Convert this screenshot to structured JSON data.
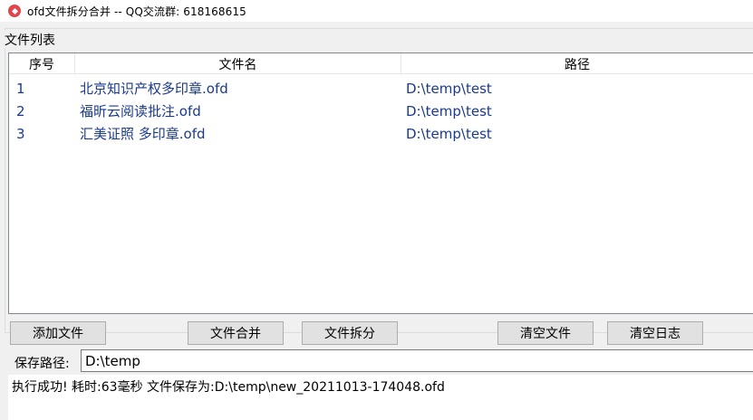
{
  "window": {
    "title": "ofd文件拆分合并 -- QQ交流群: 618168615",
    "icon": "ofd-app-icon"
  },
  "file_list": {
    "group_label": "文件列表",
    "columns": [
      "序号",
      "文件名",
      "路径"
    ],
    "rows": [
      {
        "index": "1",
        "name": "北京知识产权多印章.ofd",
        "path": "D:\\temp\\test"
      },
      {
        "index": "2",
        "name": "福昕云阅读批注.ofd",
        "path": "D:\\temp\\test"
      },
      {
        "index": "3",
        "name": "汇美证照 多印章.ofd",
        "path": "D:\\temp\\test"
      }
    ]
  },
  "toolbar": {
    "add_label": "添加文件",
    "merge_label": "文件合并",
    "split_label": "文件拆分",
    "clear_files_label": "清空文件",
    "clear_log_label": "清空日志"
  },
  "save": {
    "label": "保存路径:",
    "value": "D:\\temp"
  },
  "log": {
    "text": "执行成功! 耗时:63毫秒 文件保存为:D:\\temp\\new_20211013-174048.ofd"
  },
  "colors": {
    "accent": "#e0464a",
    "row_text": "#1a3a8c",
    "window_bg": "#f0f0f0"
  }
}
